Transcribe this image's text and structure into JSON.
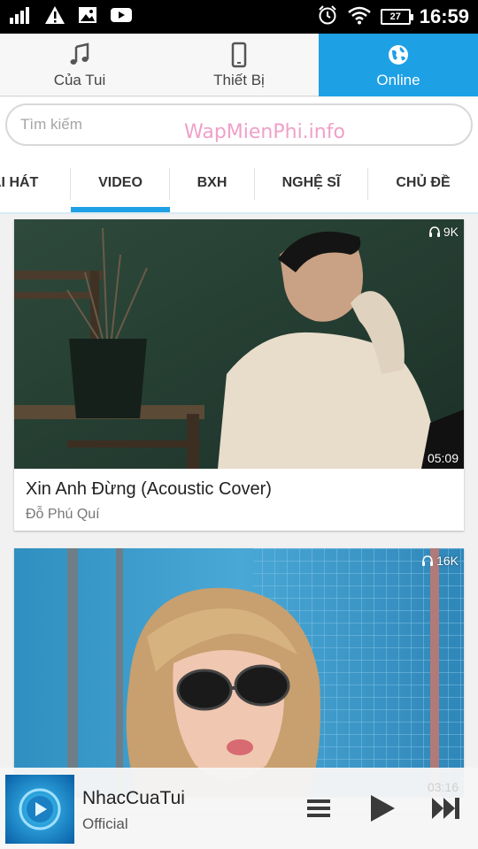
{
  "status_bar": {
    "time": "16:59",
    "battery": "27",
    "icons": [
      "signal-icon",
      "alert-icon",
      "image-icon",
      "youtube-icon",
      "alarm-icon",
      "wifi-icon",
      "battery-icon"
    ]
  },
  "top_tabs": [
    {
      "label": "Của Tui",
      "icon": "music-note-icon",
      "active": false
    },
    {
      "label": "Thiết Bị",
      "icon": "phone-icon",
      "active": false
    },
    {
      "label": "Online",
      "icon": "globe-icon",
      "active": true
    }
  ],
  "search": {
    "placeholder": "Tìm kiếm",
    "watermark": "WapMienPhi.info"
  },
  "category_tabs": [
    {
      "label": "AI HÁT",
      "active": false
    },
    {
      "label": "VIDEO",
      "active": true
    },
    {
      "label": "BXH",
      "active": false
    },
    {
      "label": "NGHỆ SĨ",
      "active": false
    },
    {
      "label": "CHỦ ĐỀ",
      "active": false
    }
  ],
  "videos": [
    {
      "title": "Xin Anh Đừng (Acoustic Cover)",
      "artist": "Đỗ Phú Quí",
      "views": "9K",
      "duration": "05:09"
    },
    {
      "title": "",
      "artist": "",
      "views": "16K",
      "duration": "03:16"
    }
  ],
  "player": {
    "title": "NhacCuaTui",
    "subtitle": "Official",
    "controls": [
      "playlist-icon",
      "play-icon",
      "next-icon"
    ]
  },
  "colors": {
    "accent": "#1ea0e5",
    "status_bar": "#000000",
    "watermark": "#f0a0c8"
  }
}
